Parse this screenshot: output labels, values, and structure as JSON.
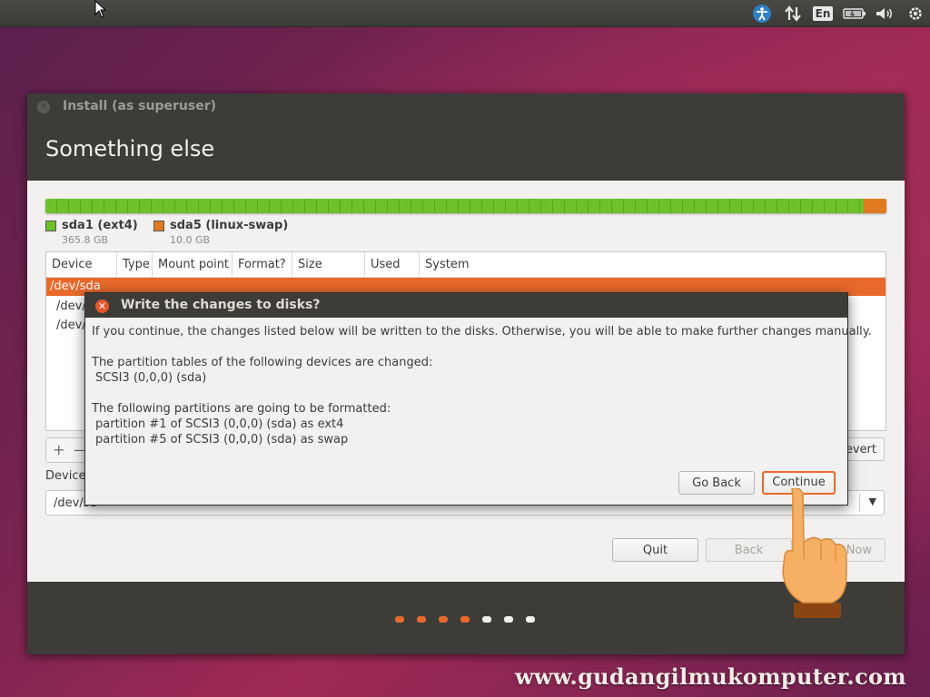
{
  "cursor": "mouse-pointer",
  "top_panel": {
    "keyboard_layout": "En",
    "icons": [
      "accessibility-icon",
      "network-icon",
      "battery-icon",
      "volume-icon",
      "settings-gear-icon"
    ]
  },
  "window": {
    "title": "Install (as superuser)",
    "page_title": "Something else"
  },
  "partitions": {
    "legend": [
      {
        "name": "sda1 (ext4)",
        "size": "365.8 GB",
        "color": "#6ec12a"
      },
      {
        "name": "sda5 (linux-swap)",
        "size": "10.0 GB",
        "color": "#e07a1f"
      }
    ],
    "usage_fraction": 0.973
  },
  "table": {
    "columns": [
      "Device",
      "Type",
      "Mount point",
      "Format?",
      "Size",
      "Used",
      "System"
    ],
    "rows": [
      "/dev/sda",
      "/dev/",
      "/dev/"
    ]
  },
  "toolbar": {
    "plus": "+",
    "minus": "—",
    "revert": "Revert"
  },
  "bootloader": {
    "label": "Device",
    "value": "/dev/sd"
  },
  "buttons": {
    "quit": "Quit",
    "back": "Back",
    "install_now": "Now"
  },
  "progress_dots": [
    {
      "color": "#e9692c"
    },
    {
      "color": "#e9692c"
    },
    {
      "color": "#e9692c"
    },
    {
      "color": "#e9692c"
    },
    {
      "color": "#f2f1f0"
    },
    {
      "color": "#f2f1f0"
    },
    {
      "color": "#f2f1f0"
    }
  ],
  "dialog": {
    "title": "Write the changes to disks?",
    "intro": "If you continue, the changes listed below will be written to the disks. Otherwise, you will be able to make further changes manually.",
    "tables_heading": "The partition tables of the following devices are changed:",
    "tables_item": "SCSI3 (0,0,0) (sda)",
    "format_heading": "The following partitions are going to be formatted:",
    "format_items": [
      "partition #1 of SCSI3 (0,0,0) (sda) as ext4",
      "partition #5 of SCSI3 (0,0,0) (sda) as swap"
    ],
    "go_back": "Go Back",
    "continue": "Continue"
  },
  "watermark": "www.gudangilmukomputer.com"
}
